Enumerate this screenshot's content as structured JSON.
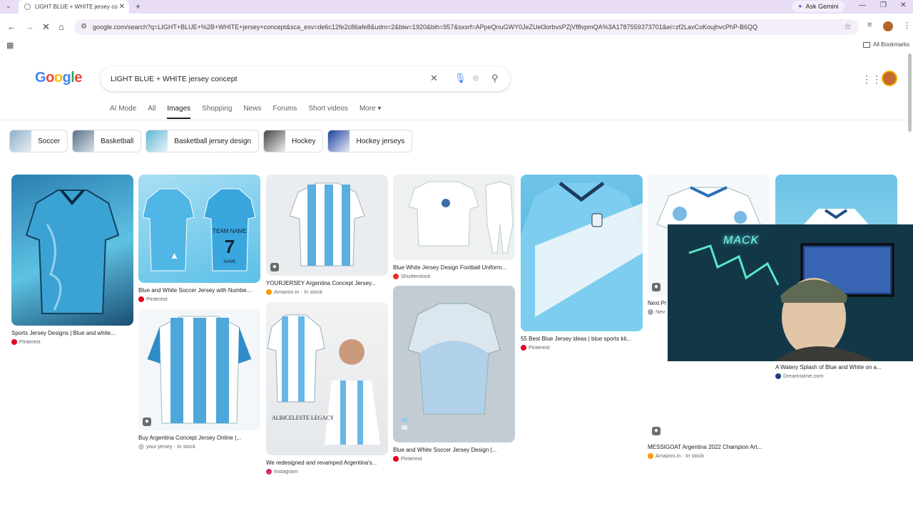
{
  "browser": {
    "tab_title": "LIGHT BLUE + WHITE jersey co",
    "url": "google.com/search?q=LIGHT+BLUE+%2B+WHITE+jersey+concept&sca_esv=de6c12fe2c86afe8&udm=2&biw=1920&bih=957&sxsrf=APpeQnuGWY0JeZUel3orbvsPZjVf8vpmQA%3A1787559373701&ei=zf2LavCoKoujhvcPhP-B6QQ",
    "ask_gemini": "Ask Gemini",
    "all_bookmarks": "All Bookmarks"
  },
  "search": {
    "query": "LIGHT BLUE + WHITE jersey concept",
    "logo": [
      "G",
      "o",
      "o",
      "g",
      "l",
      "e"
    ]
  },
  "nav_tabs": [
    "AI Mode",
    "All",
    "Images",
    "Shopping",
    "News",
    "Forums",
    "Short videos",
    "More"
  ],
  "chips": [
    "Soccer",
    "Basketball",
    "Basketball jersey design",
    "Hockey",
    "Hockey jerseys"
  ],
  "results": [
    {
      "caption": "Sports Jersey Designs | Blue and white...",
      "source": "Pinterest"
    },
    {
      "caption": "Blue and White Soccer Jersey with Numbe...",
      "source": "Pinterest"
    },
    {
      "caption": "YOURJERSEY Argentina Concept Jersey...",
      "source": "Amazon.in · In stock"
    },
    {
      "caption": "Blue White Jersey Design Football Uniform...",
      "source": "Shutterstock"
    },
    {
      "caption": "55 Best Blue Jersey ideas | blue sports kit...",
      "source": "Pinterest"
    },
    {
      "caption": "Next Pr",
      "source": "Nev"
    },
    {
      "caption": "A Watery Splash of Blue and White on a...",
      "source": "Dreamstime.com"
    },
    {
      "caption": "Buy Argentina Concept Jersey Online |...",
      "source": "your jersey · In stock"
    },
    {
      "caption": "We redesigned and revamped Argentina's...",
      "source": "Instagram"
    },
    {
      "caption": "Blue and White Soccer Jersey Design |...",
      "source": "Pinterest"
    },
    {
      "caption": "MESSIGOAT Argentina 2022 Champion Art...",
      "source": "Amazon.in · In stock"
    }
  ],
  "jersey_text": {
    "team_name": "TEAM NAME",
    "number": "7",
    "name": "NAME",
    "albiceleste": "ALBICELESTE LEGACY"
  },
  "webcam": {
    "neon": "MACK"
  },
  "colors": {
    "accent": "#1a73e8",
    "pinterest": "#e60023",
    "amazon": "#ff9900",
    "shutterstock": "#ee2b24"
  }
}
